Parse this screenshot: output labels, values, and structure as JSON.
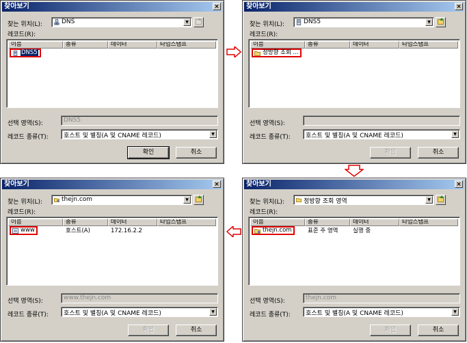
{
  "dialogs": [
    {
      "title": "찾아보기",
      "close_glyph": "×",
      "location_label": "찾는 위치(L):",
      "location_value": "DNS",
      "location_icon": "server-tree-icon",
      "up_disabled": true,
      "records_label": "레코드(R):",
      "columns": [
        "이름",
        "종류",
        "데이터",
        "타임스탬프"
      ],
      "item": {
        "name": "DNS5",
        "icon": "server-icon",
        "selected": true,
        "type": "",
        "data": ""
      },
      "selection_label": "선택 영역(S):",
      "selection_value": "DNS5",
      "record_type_label": "레코드 종류(T):",
      "record_type_value": "호스트 및 별칭(A 및 CNAME 레코드)",
      "ok_label": "확인",
      "ok_disabled": false,
      "cancel_label": "취소"
    },
    {
      "title": "찾아보기",
      "close_glyph": "×",
      "location_label": "찾는 위치(L):",
      "location_value": "DNS5",
      "location_icon": "server-icon",
      "up_disabled": false,
      "records_label": "레코드(R):",
      "columns": [
        "이름",
        "종류",
        "데이터",
        "타임스탬프"
      ],
      "item": {
        "name": "정방향 조회 ...",
        "icon": "folder-icon",
        "selected": false,
        "type": "",
        "data": ""
      },
      "selection_label": "선택 영역(S):",
      "selection_value": "",
      "record_type_label": "레코드 종류(T):",
      "record_type_value": "호스트 및 별칭(A 및 CNAME 레코드)",
      "ok_label": "확인",
      "ok_disabled": true,
      "cancel_label": "취소"
    },
    {
      "title": "찾아보기",
      "close_glyph": "×",
      "location_label": "찾는 위치(L):",
      "location_value": "thejn.com",
      "location_icon": "zone-folder-icon",
      "up_disabled": false,
      "records_label": "레코드(R):",
      "columns": [
        "이름",
        "종류",
        "데이터",
        "타임스탬프"
      ],
      "item": {
        "name": "www",
        "icon": "host-record-icon",
        "selected": false,
        "type": "호스트(A)",
        "data": "172.16.2.2"
      },
      "selection_label": "선택 영역(S):",
      "selection_value": "www.thejn.com",
      "record_type_label": "레코드 종류(T):",
      "record_type_value": "호스트 및 별칭(A 및 CNAME 레코드)",
      "ok_label": "확인",
      "ok_disabled": true,
      "cancel_label": "취소"
    },
    {
      "title": "찾아보기",
      "close_glyph": "×",
      "location_label": "찾는 위치(L):",
      "location_value": "정방향 조회 영역",
      "location_icon": "folder-icon",
      "up_disabled": false,
      "records_label": "레코드(R):",
      "columns": [
        "이름",
        "종류",
        "데이터",
        "타임스탬프"
      ],
      "item": {
        "name": "thejn.com",
        "icon": "zone-folder-icon",
        "selected": false,
        "type": "표준 주 영역",
        "data": "실행 중"
      },
      "selection_label": "선택 영역(S):",
      "selection_value": "thejn.com",
      "record_type_label": "레코드 종류(T):",
      "record_type_value": "호스트 및 별칭(A 및 CNAME 레코드)",
      "ok_label": "확인",
      "ok_disabled": true,
      "cancel_label": "취소"
    }
  ],
  "flow_arrow_color": "#e00000",
  "highlight_color": "#e00000"
}
